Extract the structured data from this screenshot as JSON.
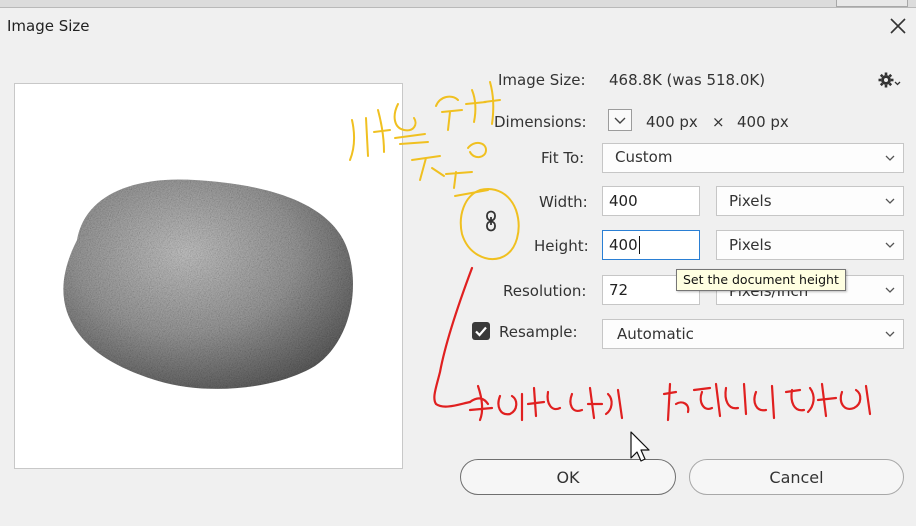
{
  "dialog": {
    "title": "Image Size",
    "close_icon": "close-icon",
    "settings_icon": "gear-icon"
  },
  "info": {
    "image_size_label": "Image Size:",
    "image_size_value": "468.8K (was 518.0K)",
    "dimensions_label": "Dimensions:",
    "dimensions_width": "400 px",
    "dimensions_sep": "×",
    "dimensions_height": "400 px"
  },
  "fit_to": {
    "label": "Fit To:",
    "value": "Custom"
  },
  "width": {
    "label": "Width:",
    "value": "400",
    "unit": "Pixels"
  },
  "height": {
    "label": "Height:",
    "value": "400",
    "unit": "Pixels"
  },
  "resolution": {
    "label": "Resolution:",
    "value": "72",
    "unit": "Pixels/Inch"
  },
  "resample": {
    "label": "Resample:",
    "checked": true,
    "value": "Automatic"
  },
  "tooltip": {
    "text": "Set the document height"
  },
  "buttons": {
    "ok": "OK",
    "cancel": "Cancel"
  },
  "colors": {
    "accent": "#2a7fd4",
    "annotation_yellow": "#f0c020",
    "annotation_red": "#e02020"
  }
}
